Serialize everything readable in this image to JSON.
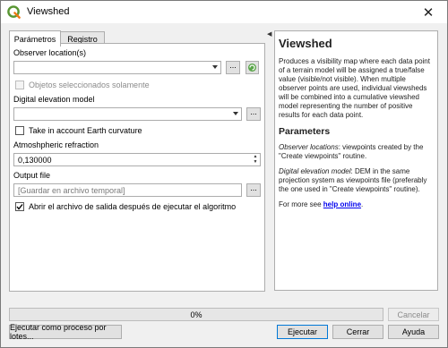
{
  "window": {
    "title": "Viewshed"
  },
  "tabs": [
    {
      "label": "Parámetros"
    },
    {
      "label": "Registro"
    }
  ],
  "form": {
    "observer_label": "Observer location(s)",
    "selected_only_label": "Objetos seleccionados solamente",
    "dem_label": "Digital elevation model",
    "curvature_label": "Take in account Earth curvature",
    "refraction_label": "Atmoshpheric refraction",
    "refraction_value": "0,130000",
    "output_label": "Output file",
    "output_placeholder": "[Guardar en archivo temporal]",
    "open_output_label": "Abrir el archivo de salida después de ejecutar el algoritmo",
    "open_output_checked": true,
    "curvature_checked": false,
    "selected_only_checked": false,
    "browse_label": "..."
  },
  "help": {
    "title": "Viewshed",
    "intro": "Produces a visibility map where each data point of a terrain model will be assigned a true/false value (visible/not visible). When multiple observer points are used, individual viewsheds will be combined into a cumulative viewshed model representing the number of positive results for each data point.",
    "parameters_heading": "Parameters",
    "observer_term": "Observer locations",
    "observer_desc": ": viewpoints created by the \"Create viewpoints\" routine.",
    "dem_term": "Digital elevation model",
    "dem_desc": ": DEM in the same projection system as viewpoints file (preferably the one used in \"Create viewpoints\" routine).",
    "more_prefix": "For more see ",
    "more_link": "help online",
    "more_suffix": "."
  },
  "progress": {
    "text": "0%",
    "value": 0
  },
  "buttons": {
    "cancel": "Cancelar",
    "batch": "Ejecutar como proceso por lotes...",
    "run": "Ejecutar",
    "close": "Cerrar",
    "help": "Ayuda"
  },
  "icons": {
    "app": "qgis-logo-icon",
    "close": "close-icon",
    "refresh": "refresh-icon",
    "collapse": "collapse-arrow-icon"
  },
  "colors": {
    "app_green": "#589632",
    "link": "#0000ee"
  }
}
